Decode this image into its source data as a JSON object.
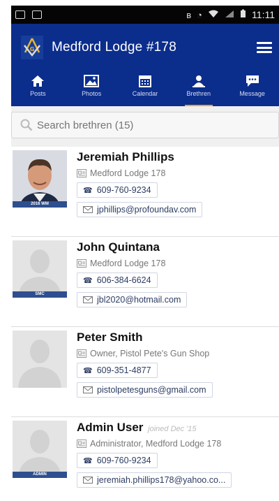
{
  "status_bar": {
    "time": "11:11"
  },
  "app": {
    "title": "Medford Lodge #178"
  },
  "tabs": [
    {
      "label": "Posts",
      "icon": "home-icon"
    },
    {
      "label": "Photos",
      "icon": "photo-icon"
    },
    {
      "label": "Calendar",
      "icon": "calendar-icon"
    },
    {
      "label": "Brethren",
      "icon": "people-icon",
      "active": true
    },
    {
      "label": "Message",
      "icon": "chat-icon"
    }
  ],
  "search": {
    "placeholder": "Search brethren (15)"
  },
  "members": [
    {
      "name": "Jeremiah Phillips",
      "badge": "2016 WM",
      "org": "Medford Lodge 178",
      "phone": "609-760-9234",
      "email": "jphillips@profoundav.com",
      "joined": ""
    },
    {
      "name": "John Quintana",
      "badge": "SMC",
      "org": "Medford Lodge 178",
      "phone": "606-384-6624",
      "email": "jbl2020@hotmail.com",
      "joined": ""
    },
    {
      "name": "Peter Smith",
      "badge": "",
      "org": "Owner, Pistol Pete's Gun Shop",
      "phone": "609-351-4877",
      "email": "pistolpetesguns@gmail.com",
      "joined": ""
    },
    {
      "name": "Admin User",
      "badge": "ADMIN",
      "org": "Administrator, Medford Lodge 178",
      "phone": "609-760-9234",
      "email": "jeremiah.phillips178@yahoo.co...",
      "joined": "joined Dec '15"
    }
  ],
  "colors": {
    "app_bar": "#0b2d8c",
    "accent": "#f5a623",
    "badge": "#2e4f8f"
  }
}
